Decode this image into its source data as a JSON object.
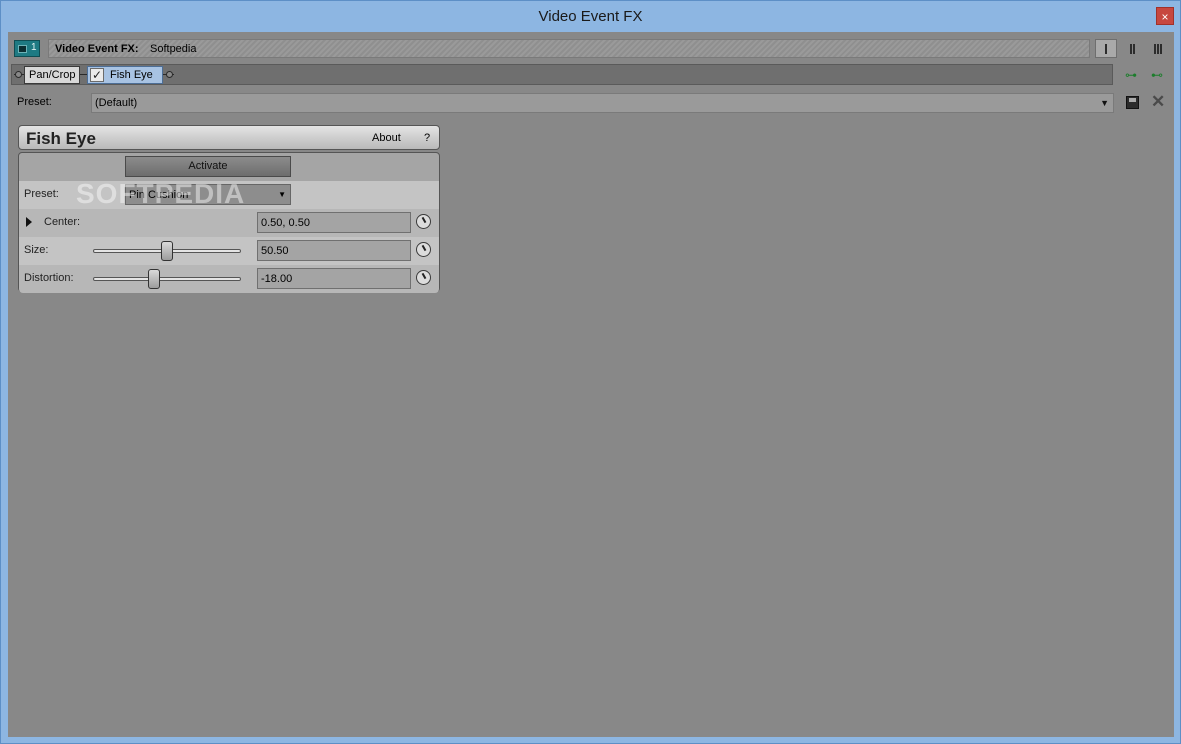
{
  "window": {
    "title": "Video Event FX",
    "close_glyph": "×"
  },
  "header": {
    "chain_number": "1",
    "fx_label": "Video Event FX:",
    "fx_value": "Softpedia"
  },
  "chain": {
    "plugins": [
      {
        "label": "Pan/Crop",
        "checked": false
      },
      {
        "label": "Fish Eye",
        "checked": true
      }
    ]
  },
  "preset": {
    "label": "Preset:",
    "value": "(Default)"
  },
  "plugin": {
    "name": "Fish Eye",
    "about_label": "About",
    "help_label": "?",
    "activate_label": "Activate",
    "preset_label": "Preset:",
    "preset_value": "Pin Cushion",
    "params": {
      "center": {
        "label": "Center:",
        "value": "0.50, 0.50"
      },
      "size": {
        "label": "Size:",
        "value": "50.50",
        "slider_fraction": 0.5
      },
      "distortion": {
        "label": "Distortion:",
        "value": "-18.00",
        "slider_fraction": 0.41
      }
    }
  },
  "watermark": "SOFTPEDIA",
  "colors": {
    "client_bg": "#888888",
    "titlebar": "#8db6e2",
    "selected_plugin": "#a8c3e3"
  }
}
